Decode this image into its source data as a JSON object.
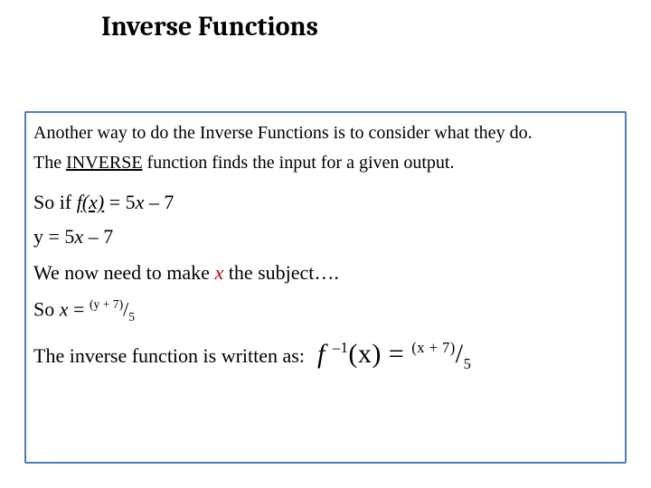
{
  "title": "Inverse Functions",
  "body": {
    "p1": "Another way to do the Inverse Functions is to consider what they do.",
    "p2_a": "The ",
    "p2_inverse": "INVERSE",
    "p2_b": " function finds the input for a given output.",
    "p3_a": "So if ",
    "p3_fx": "f(x)",
    "p3_b": " = 5",
    "p3_x1": "x",
    "p3_c": " – 7",
    "p4_a": "y = 5",
    "p4_x": "x",
    "p4_b": " – 7",
    "p5_a": "We now need to make ",
    "p5_x": "x",
    "p5_b": " the subject….",
    "p6_a": "So ",
    "p6_x": "x",
    "p6_b": " = ",
    "p6_num": "(y + 7)",
    "p6_slash": "/",
    "p6_den": "5",
    "p7_label": "The inverse function is written as:",
    "p7_f": "f ",
    "p7_inv": "–1",
    "p7_xpart": "(x) = ",
    "p7_num": "(x + 7)",
    "p7_slash": "/",
    "p7_den": "5"
  }
}
